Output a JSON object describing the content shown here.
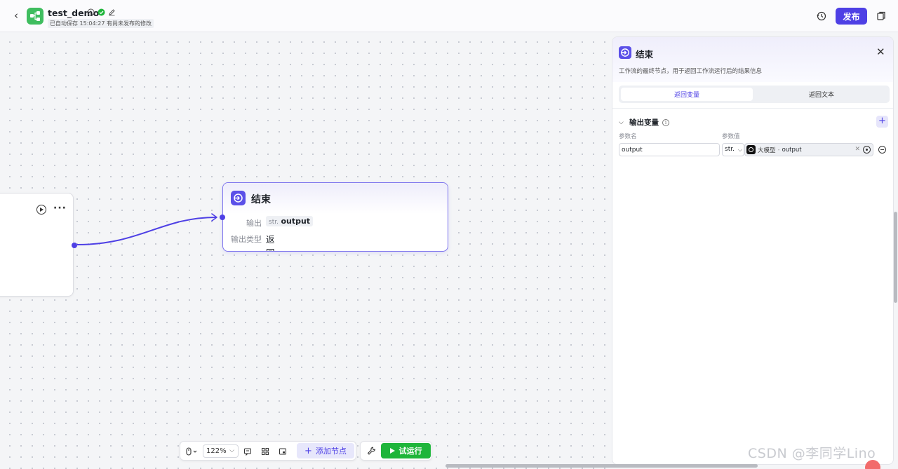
{
  "header": {
    "back_icon": "chevron-left-icon",
    "app_title": "test_demo",
    "saved_text": "已自动保存 15:04:27",
    "unpublished_text": "有尚未发布的修改",
    "publish_label": "发布",
    "accent_color": "#4e40e5"
  },
  "canvas": {
    "end_node": {
      "title": "结束",
      "output_label": "输出",
      "output_type_tag": "str.",
      "output_value": "output",
      "output_type_label": "输出类型",
      "output_type_value": "返回变量"
    }
  },
  "toolbar": {
    "zoom": "122%",
    "add_node_label": "添加节点",
    "trial_run_label": "试运行",
    "trial_color": "#1eb53a"
  },
  "panel": {
    "title": "结束",
    "description": "工作流的最终节点，用于返回工作流运行后的结果信息",
    "tabs": [
      {
        "label": "返回变量",
        "active": true
      },
      {
        "label": "返回文本",
        "active": false
      }
    ],
    "section_title": "输出变量",
    "col_param_name": "参数名",
    "col_param_value": "参数值",
    "row": {
      "name": "output",
      "type": "str.",
      "ref_node": "大模型",
      "ref_sep": "-",
      "ref_var": "output"
    }
  },
  "watermark": "CSDN @李同学Lino"
}
